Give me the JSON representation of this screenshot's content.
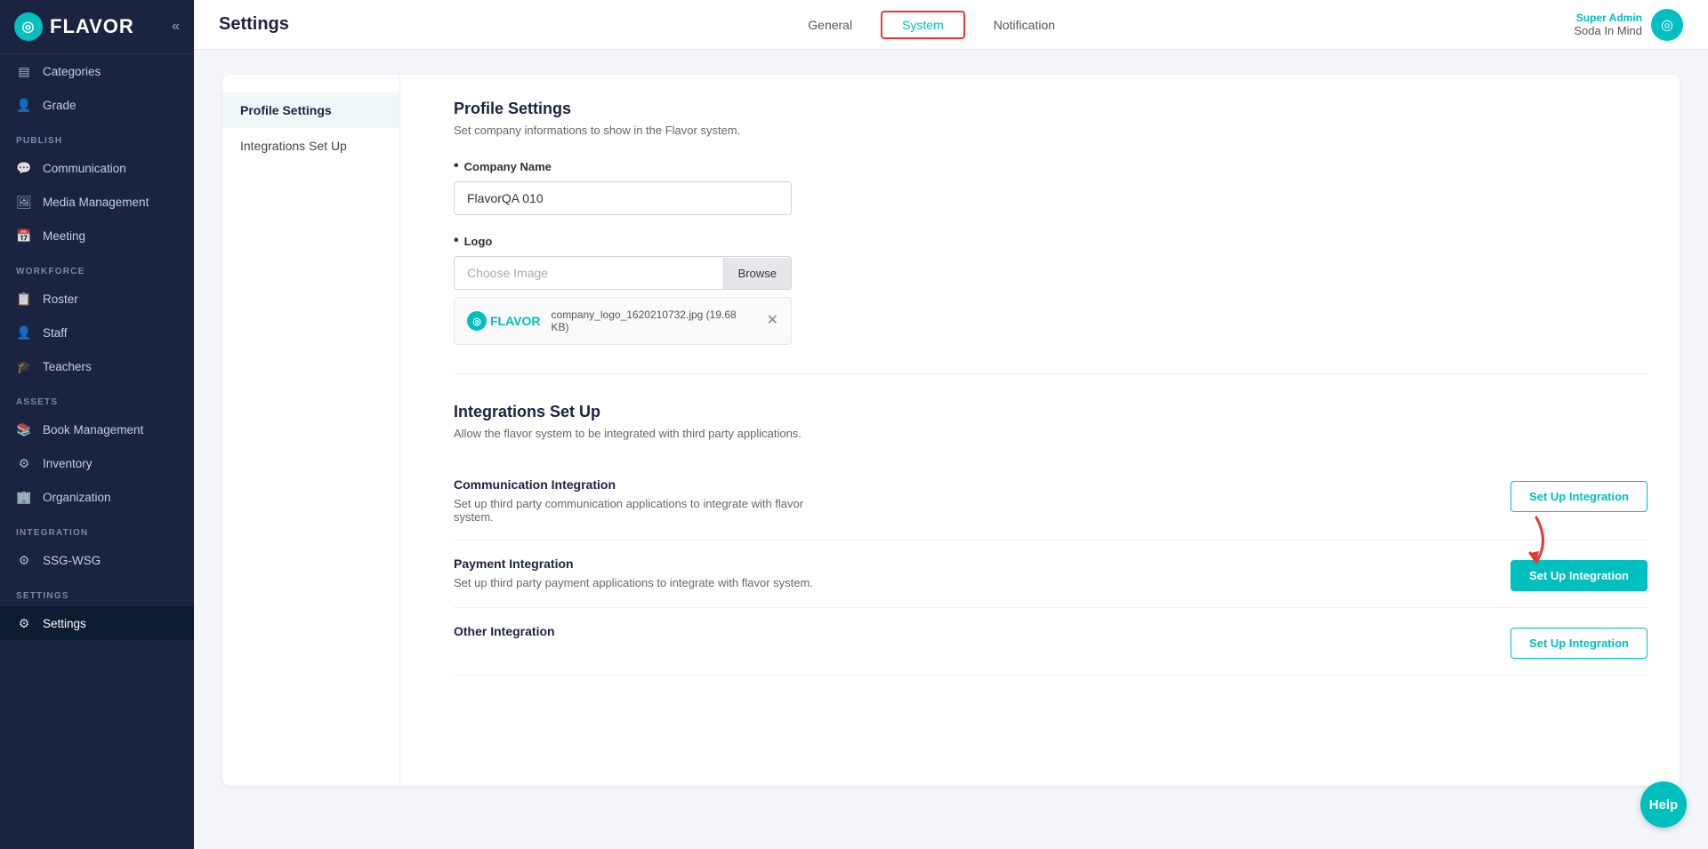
{
  "brand": {
    "name": "FLAVOR",
    "icon": "◎"
  },
  "user": {
    "role": "Super Admin",
    "company": "Soda In Mind",
    "avatar_icon": "◎"
  },
  "sidebar": {
    "collapse_icon": "«",
    "sections": [
      {
        "label": "",
        "items": [
          {
            "id": "categories",
            "label": "Categories",
            "icon": "▤"
          },
          {
            "id": "grade",
            "label": "Grade",
            "icon": "👤"
          }
        ]
      },
      {
        "label": "PUBLISH",
        "items": [
          {
            "id": "communication",
            "label": "Communication",
            "icon": "💬"
          },
          {
            "id": "media-management",
            "label": "Media Management",
            "icon": "🖼"
          },
          {
            "id": "meeting",
            "label": "Meeting",
            "icon": "📅"
          }
        ]
      },
      {
        "label": "WORKFORCE",
        "items": [
          {
            "id": "roster",
            "label": "Roster",
            "icon": "📋"
          },
          {
            "id": "staff",
            "label": "Staff",
            "icon": "👤"
          },
          {
            "id": "teachers",
            "label": "Teachers",
            "icon": "🎓"
          }
        ]
      },
      {
        "label": "ASSETS",
        "items": [
          {
            "id": "book-management",
            "label": "Book Management",
            "icon": "📚"
          },
          {
            "id": "inventory",
            "label": "Inventory",
            "icon": "⚙"
          },
          {
            "id": "organization",
            "label": "Organization",
            "icon": "🏢"
          }
        ]
      },
      {
        "label": "INTEGRATION",
        "items": [
          {
            "id": "ssg-wsg",
            "label": "SSG-WSG",
            "icon": "⚙"
          }
        ]
      },
      {
        "label": "SETTINGS",
        "items": [
          {
            "id": "settings",
            "label": "Settings",
            "icon": "⚙",
            "active": true
          }
        ]
      }
    ]
  },
  "topbar": {
    "title": "Settings",
    "tabs": [
      {
        "id": "general",
        "label": "General",
        "active": false
      },
      {
        "id": "system",
        "label": "System",
        "active": true
      },
      {
        "id": "notification",
        "label": "Notification",
        "active": false
      }
    ]
  },
  "settings_nav": [
    {
      "id": "profile-settings",
      "label": "Profile Settings",
      "active": true
    },
    {
      "id": "integrations-setup",
      "label": "Integrations Set Up",
      "active": false
    }
  ],
  "profile_settings": {
    "title": "Profile Settings",
    "description": "Set company informations to show in the Flavor system.",
    "fields": {
      "company_name_label": "Company Name",
      "company_name_value": "FlavorQA 010",
      "logo_label": "Logo",
      "logo_placeholder": "Choose Image",
      "browse_btn": "Browse",
      "file_name": "company_logo_1620210732.jpg (19.68 KB)",
      "file_logo_text": "FLAVOR"
    }
  },
  "integrations_setup": {
    "title": "Integrations Set Up",
    "description": "Allow the flavor system to be integrated with third party applications.",
    "integrations": [
      {
        "id": "communication",
        "title": "Communication Integration",
        "description": "Set up third party communication applications to integrate with flavor system.",
        "btn_label": "Set Up Integration",
        "btn_style": "outline"
      },
      {
        "id": "payment",
        "title": "Payment Integration",
        "description": "Set up third party payment applications to integrate with flavor system.",
        "btn_label": "Set Up Integration",
        "btn_style": "filled"
      },
      {
        "id": "other",
        "title": "Other Integration",
        "description": "",
        "btn_label": "Set Up Integration",
        "btn_style": "outline"
      }
    ]
  },
  "help_btn": "Help"
}
